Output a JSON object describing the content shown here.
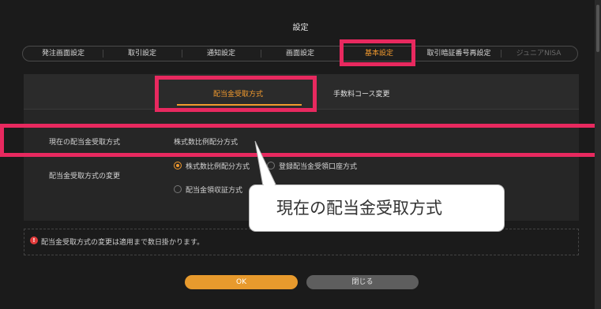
{
  "dialog": {
    "title": "設定"
  },
  "tabs": [
    {
      "label": "発注画面設定"
    },
    {
      "label": "取引設定"
    },
    {
      "label": "通知設定"
    },
    {
      "label": "画面設定"
    },
    {
      "label": "基本設定"
    },
    {
      "label": "取引暗証番号再設定"
    },
    {
      "label": "ジュニアNISA"
    }
  ],
  "subtabs": [
    {
      "label": "配当金受取方式"
    },
    {
      "label": "手数料コース変更"
    }
  ],
  "current_method": {
    "label": "現在の配当金受取方式",
    "value": "株式数比例配分方式"
  },
  "change_method": {
    "label": "配当金受取方式の変更",
    "options": [
      {
        "label": "株式数比例配分方式",
        "checked": true
      },
      {
        "label": "登録配当金受領口座方式",
        "checked": false
      },
      {
        "label": "配当金領収証方式",
        "checked": false
      }
    ]
  },
  "notice": {
    "icon": "warning-icon",
    "text": "配当金受取方式の変更は適用まで数日掛かります。"
  },
  "buttons": {
    "ok": "OK",
    "close": "閉じる"
  },
  "callout": {
    "text": "現在の配当金受取方式"
  },
  "colors": {
    "accent": "#f29a2e",
    "highlight": "#e8295f"
  }
}
